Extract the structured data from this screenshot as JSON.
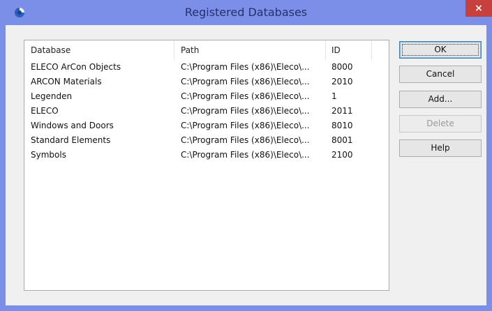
{
  "window": {
    "title": "Registered Databases",
    "close_label": "×",
    "colors": {
      "frame": "#7b8fe8",
      "close": "#c7403b",
      "title_text": "#26306a"
    }
  },
  "list": {
    "columns": [
      "Database",
      "Path",
      "ID"
    ],
    "rows": [
      {
        "database": "ELECO ArCon Objects",
        "path": "C:\\Program Files (x86)\\Eleco\\...",
        "id": "8000"
      },
      {
        "database": "ARCON Materials",
        "path": "C:\\Program Files (x86)\\Eleco\\...",
        "id": "2010"
      },
      {
        "database": "Legenden",
        "path": "C:\\Program Files (x86)\\Eleco\\...",
        "id": "1"
      },
      {
        "database": "ELECO",
        "path": "C:\\Program Files (x86)\\Eleco\\...",
        "id": "2011"
      },
      {
        "database": "Windows and Doors",
        "path": "C:\\Program Files (x86)\\Eleco\\...",
        "id": "8010"
      },
      {
        "database": "Standard Elements",
        "path": "C:\\Program Files (x86)\\Eleco\\...",
        "id": "8001"
      },
      {
        "database": "Symbols",
        "path": "C:\\Program Files (x86)\\Eleco\\...",
        "id": "2100"
      }
    ]
  },
  "buttons": {
    "ok": "OK",
    "cancel": "Cancel",
    "add": "Add...",
    "delete": "Delete",
    "help": "Help"
  }
}
